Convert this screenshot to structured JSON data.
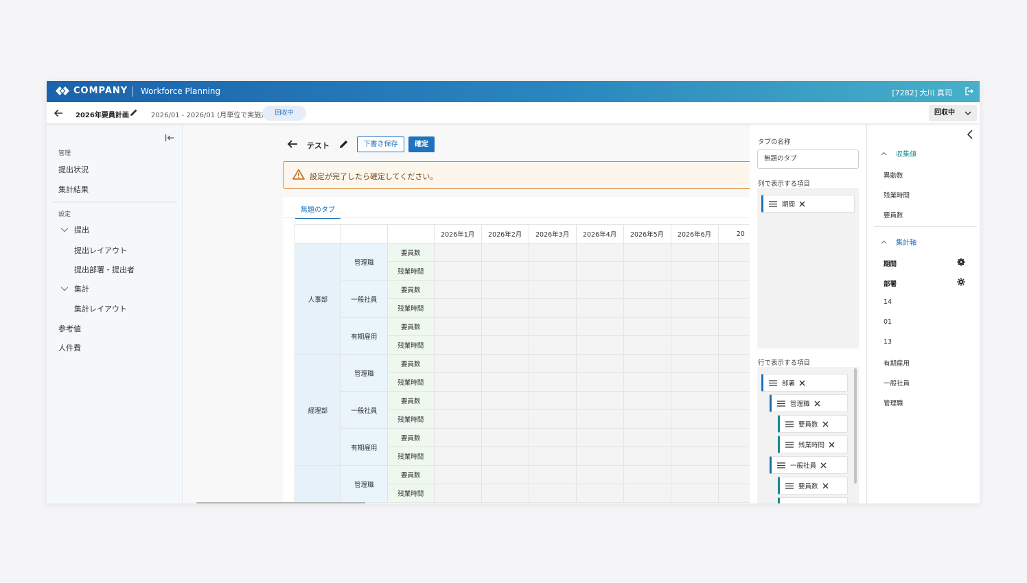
{
  "header": {
    "brand": "COMPANY",
    "app_name": "Workforce Planning",
    "user": "[7282] 大川 真司"
  },
  "subheader": {
    "title": "2026年要員計画",
    "period": "2026/01 - 2026/01 (月単位で実施)",
    "status_badge": "回収中",
    "status_dropdown": "回収中"
  },
  "sidebar": {
    "section_manage": "管理",
    "item_status": "提出状況",
    "item_results": "集計結果",
    "section_settings": "設定",
    "group_submit": "提出",
    "item_submit_layout": "提出レイアウト",
    "item_submit_dept": "提出部署・提出者",
    "group_aggregate": "集計",
    "item_aggregate_layout": "集計レイアウト",
    "item_reference": "参考値",
    "item_labor": "人件費"
  },
  "editor": {
    "title": "テスト",
    "draft_button": "下書き保存",
    "confirm_button": "確定",
    "alert": "設定が完了したら確定してください。",
    "tab": "無題のタブ"
  },
  "grid": {
    "columns": [
      "2026年1月",
      "2026年2月",
      "2026年3月",
      "2026年4月",
      "2026年5月",
      "2026年6月",
      "20"
    ],
    "rows": [
      {
        "dept": "人事部",
        "classes": [
          {
            "name": "管理職",
            "metrics": [
              "要員数",
              "残業時間"
            ]
          },
          {
            "name": "一般社員",
            "metrics": [
              "要員数",
              "残業時間"
            ]
          },
          {
            "name": "有期雇用",
            "metrics": [
              "要員数",
              "残業時間"
            ]
          }
        ]
      },
      {
        "dept": "経理部",
        "classes": [
          {
            "name": "管理職",
            "metrics": [
              "要員数",
              "残業時間"
            ]
          },
          {
            "name": "一般社員",
            "metrics": [
              "要員数",
              "残業時間"
            ]
          },
          {
            "name": "有期雇用",
            "metrics": [
              "要員数",
              "残業時間"
            ]
          }
        ]
      },
      {
        "dept": "",
        "classes": [
          {
            "name": "管理職",
            "metrics": [
              "要員数",
              "残業時間"
            ]
          }
        ]
      }
    ]
  },
  "config": {
    "tab_name_label": "タブの名称",
    "tab_name_value": "無題のタブ",
    "columns_label": "列で表示する項目",
    "column_chip": "期間",
    "rows_label": "行で表示する項目",
    "row_chips": [
      "部署",
      "管理職",
      "要員数",
      "残業時間",
      "一般社員",
      "要員数"
    ]
  },
  "rightpanel": {
    "group_values": "収集値",
    "values": [
      "異動数",
      "残業時間",
      "要員数"
    ],
    "group_axes": "集計軸",
    "axes_bold": [
      "期間",
      "部署"
    ],
    "axes": [
      "14",
      "01",
      "13",
      "有期雇用",
      "一般社員",
      "管理職"
    ]
  },
  "colors": {
    "primary": "#1e73be",
    "alert_border": "#d98a3d",
    "teal": "#1a8a8a"
  }
}
